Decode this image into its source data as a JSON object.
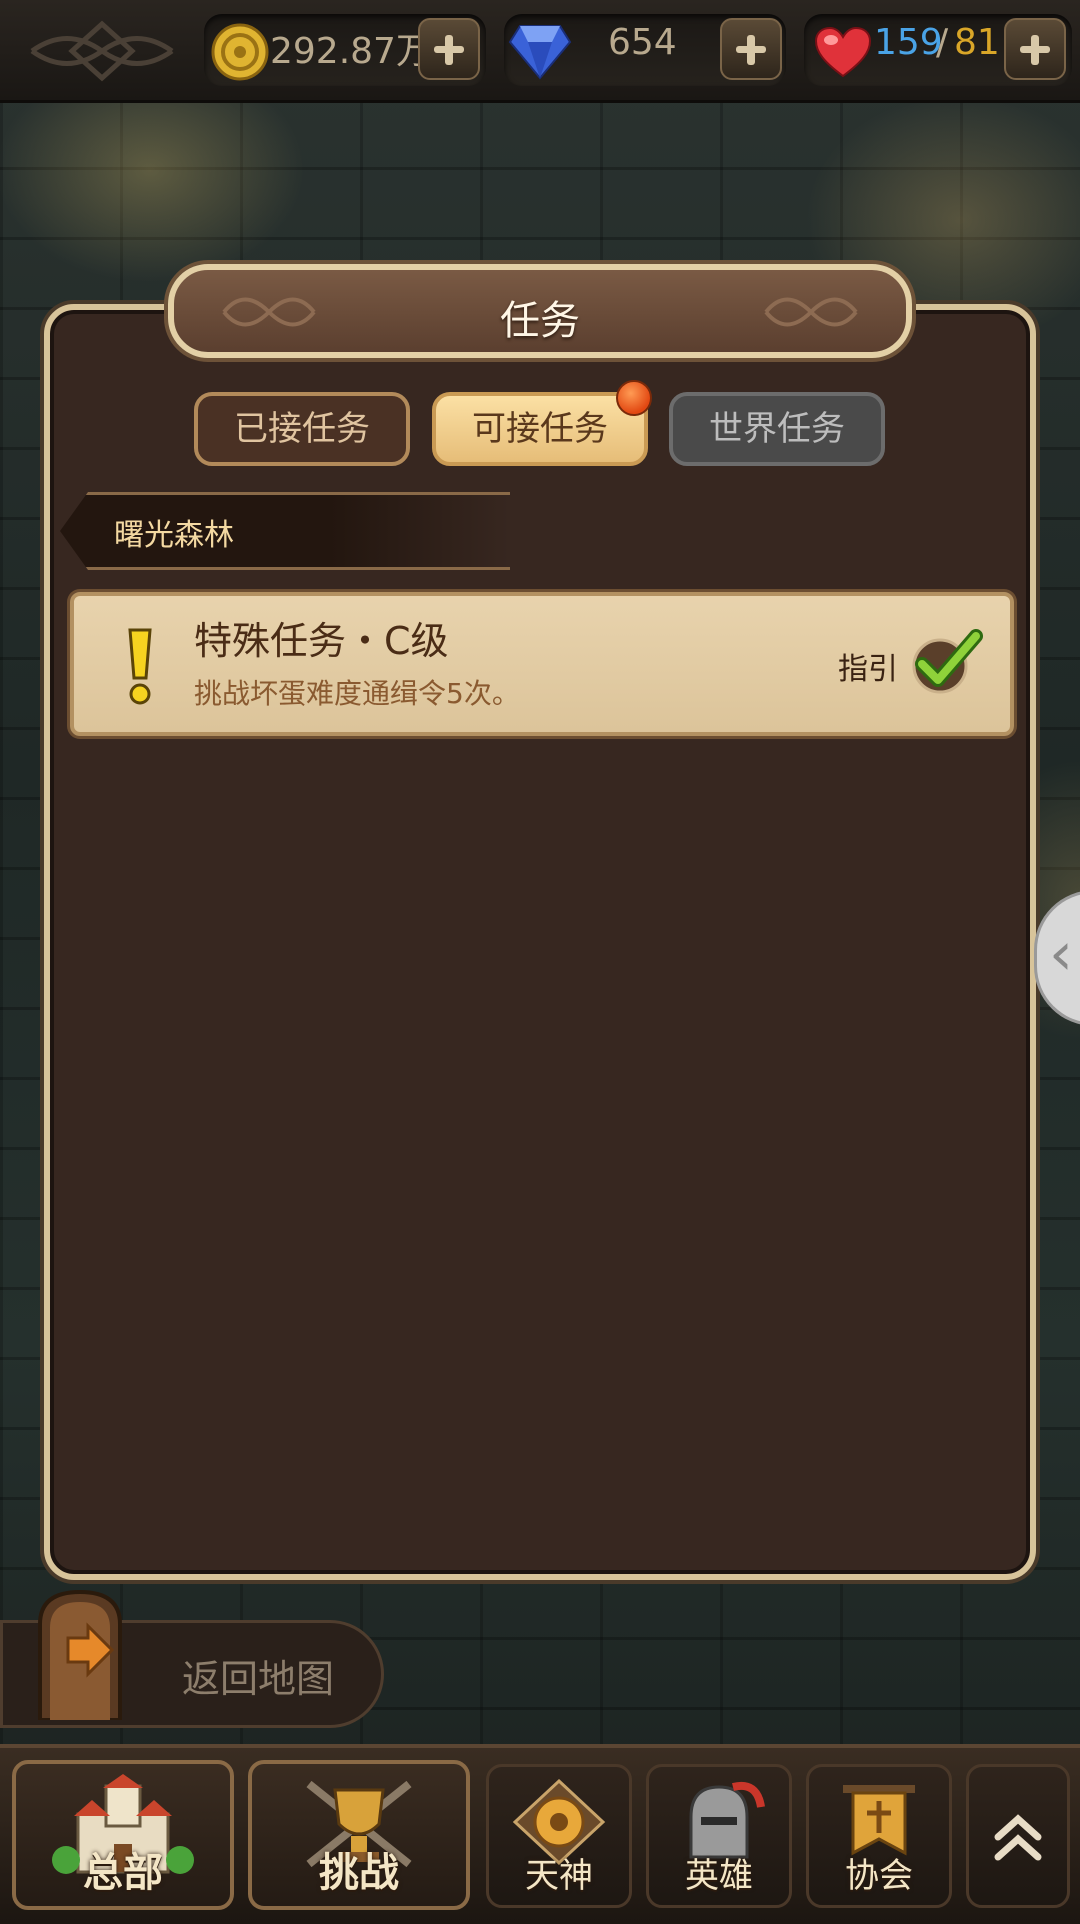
{
  "resources": {
    "gold": {
      "value": "292.87万",
      "icon": "gold-coin-icon"
    },
    "gems": {
      "value": "654",
      "icon": "diamond-icon"
    },
    "stamina": {
      "current": "159",
      "separator": "/",
      "max": "81",
      "icon": "heart-icon"
    }
  },
  "panel": {
    "title": "任务",
    "tabs": [
      {
        "label": "已接任务",
        "state": "inactive"
      },
      {
        "label": "可接任务",
        "state": "selected",
        "has_notification": true
      },
      {
        "label": "世界任务",
        "state": "disabled"
      }
    ],
    "region": "曙光森林",
    "quests": [
      {
        "title": "特殊任务・C级",
        "description": "挑战坏蛋难度通缉令5次。",
        "guide_label": "指引",
        "status_icon": "check-icon"
      }
    ]
  },
  "return_to_map": "返回地图",
  "bottom_nav": [
    {
      "label": "总部",
      "icon": "castle-icon"
    },
    {
      "label": "挑战",
      "icon": "trophy-icon"
    },
    {
      "label": "天神",
      "icon": "deity-emblem-icon"
    },
    {
      "label": "英雄",
      "icon": "helmet-icon"
    },
    {
      "label": "协会",
      "icon": "banner-icon"
    },
    {
      "label": "",
      "icon": "double-chevron-up-icon"
    }
  ],
  "colors": {
    "panel_bg": "#372720",
    "panel_border": "#d8c49a",
    "stamina_current": "#4aa3e6",
    "stamina_max": "#d9a628"
  }
}
